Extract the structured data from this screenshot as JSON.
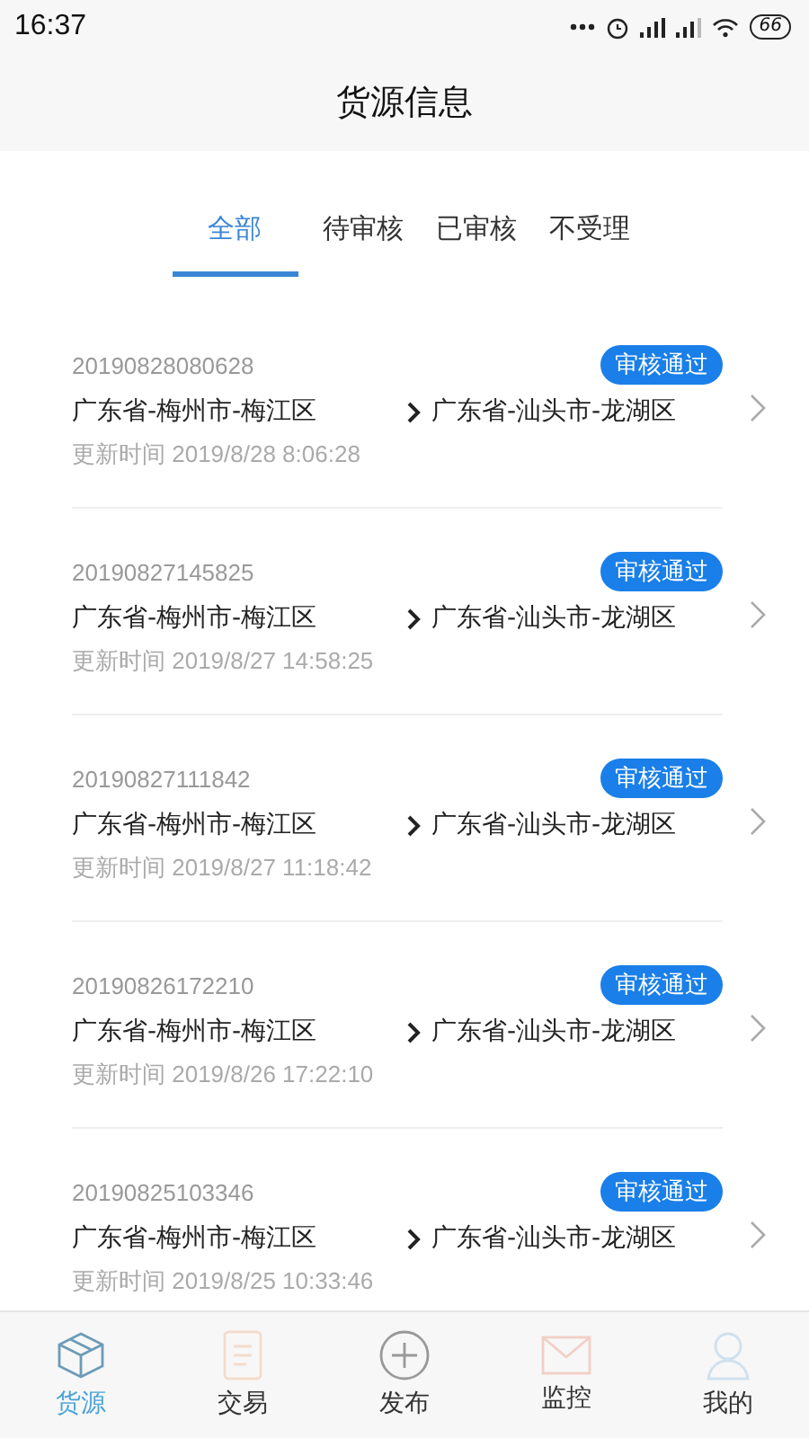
{
  "status_bar": {
    "time": "16:37",
    "battery": "66"
  },
  "header": {
    "title": "货源信息"
  },
  "tabs": [
    {
      "label": "全部",
      "selected": true
    },
    {
      "label": "待审核",
      "selected": false
    },
    {
      "label": "已审核",
      "selected": false
    },
    {
      "label": "不受理",
      "selected": false
    }
  ],
  "orders": [
    {
      "id": "20190828080628",
      "status": "审核通过",
      "from": "广东省-梅州市-梅江区",
      "to": "广东省-汕头市-龙湖区",
      "updated": "更新时间 2019/8/28 8:06:28"
    },
    {
      "id": "20190827145825",
      "status": "审核通过",
      "from": "广东省-梅州市-梅江区",
      "to": "广东省-汕头市-龙湖区",
      "updated": "更新时间 2019/8/27 14:58:25"
    },
    {
      "id": "20190827111842",
      "status": "审核通过",
      "from": "广东省-梅州市-梅江区",
      "to": "广东省-汕头市-龙湖区",
      "updated": "更新时间 2019/8/27 11:18:42"
    },
    {
      "id": "20190826172210",
      "status": "审核通过",
      "from": "广东省-梅州市-梅江区",
      "to": "广东省-汕头市-龙湖区",
      "updated": "更新时间 2019/8/26 17:22:10"
    },
    {
      "id": "20190825103346",
      "status": "审核通过",
      "from": "广东省-梅州市-梅江区",
      "to": "广东省-汕头市-龙湖区",
      "updated": "更新时间 2019/8/25 10:33:46"
    }
  ],
  "bottom_nav": [
    {
      "label": "货源",
      "kind": "box",
      "selected": true
    },
    {
      "label": "交易",
      "kind": "document",
      "selected": false
    },
    {
      "label": "发布",
      "kind": "plus",
      "selected": false
    },
    {
      "label": "监控",
      "kind": "envelope",
      "selected": false
    },
    {
      "label": "我的",
      "kind": "person",
      "selected": false
    }
  ]
}
